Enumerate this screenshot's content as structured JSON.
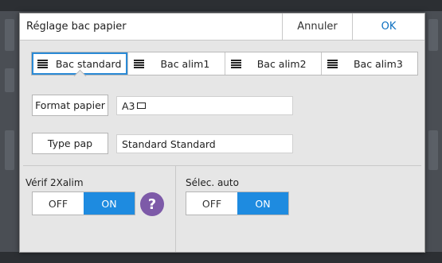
{
  "dialog": {
    "title": "Réglage bac papier",
    "cancel_label": "Annuler",
    "ok_label": "OK"
  },
  "tabs": [
    {
      "label": "Bac standard",
      "active": true
    },
    {
      "label": "Bac alim1",
      "active": false
    },
    {
      "label": "Bac alim2",
      "active": false
    },
    {
      "label": "Bac alim3",
      "active": false
    }
  ],
  "paper_format": {
    "button_label": "Format papier",
    "value": "A3"
  },
  "paper_type": {
    "button_label": "Type pap",
    "value": "Standard Standard"
  },
  "double_feed_check": {
    "label": "Vérif 2Xalim",
    "off_label": "OFF",
    "on_label": "ON",
    "selected": "ON",
    "help_label": "?"
  },
  "auto_select": {
    "label": "Sélec. auto",
    "off_label": "OFF",
    "on_label": "ON",
    "selected": "ON"
  },
  "colors": {
    "accent": "#1e8be0",
    "help": "#7d5aa8",
    "ok_text": "#0b6fc0"
  }
}
